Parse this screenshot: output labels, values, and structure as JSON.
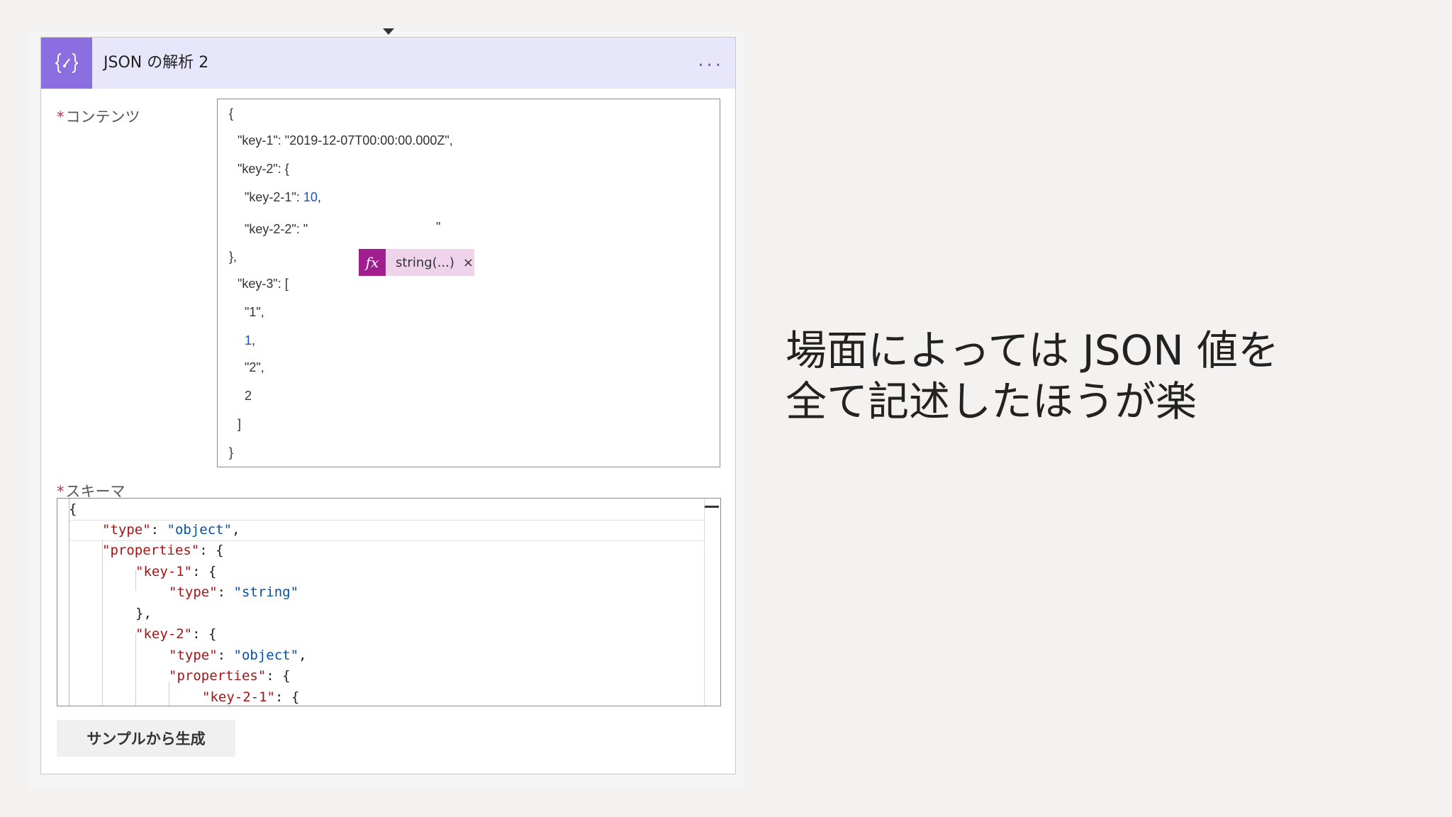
{
  "action": {
    "title": "JSON の解析 2",
    "more_label": "..."
  },
  "content_field": {
    "required_mark": "*",
    "label": "コンテンツ",
    "lines": [
      "{",
      "\"key-1\": \"2019-12-07T00:00:00.000Z\",",
      "\"key-2\": {",
      "\"key-2-1\": ",
      "10",
      ",",
      "\"key-2-2\": \"",
      "\"",
      "},",
      "\"key-3\": [",
      "\"1\",",
      "1",
      ",",
      "\"2\",",
      "2",
      "]",
      "}"
    ],
    "token": {
      "fx": "fx",
      "label": "string(...)",
      "close": "×"
    }
  },
  "schema_field": {
    "required_mark": "*",
    "label": "スキーマ",
    "code": {
      "l0": "{",
      "type_key": "\"type\"",
      "type_val": "\"object\"",
      "props_key": "\"properties\"",
      "key1": "\"key-1\"",
      "key1_type_key": "\"type\"",
      "key1_type_val": "\"string\"",
      "close1": "},",
      "key2": "\"key-2\"",
      "key2_type_key": "\"type\"",
      "key2_type_val": "\"object\"",
      "key2_props_key": "\"properties\"",
      "key21": "\"key-2-1\""
    }
  },
  "generate_button": {
    "label": "サンプルから生成"
  },
  "note": {
    "line1": "場面によっては JSON 値を",
    "line2": "全て記述したほうが楽"
  },
  "colors": {
    "header_bg": "#e8e6fb",
    "icon_bg": "#8b6fe0",
    "token_bg": "#eed3ea",
    "token_fx_bg": "#a01e8e",
    "required": "#c4314b"
  },
  "icons": {
    "action": "curly-braces-icon",
    "expression": "fx-icon"
  }
}
